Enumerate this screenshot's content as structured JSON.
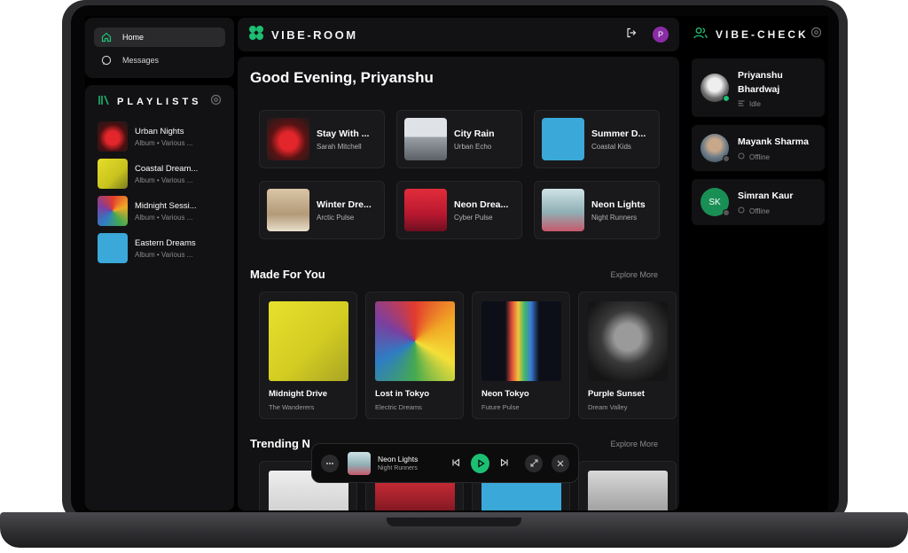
{
  "nav": {
    "items": [
      {
        "label": "Home",
        "icon": "home-icon"
      },
      {
        "label": "Messages",
        "icon": "chat-icon"
      }
    ]
  },
  "playlists": {
    "title": "PLAYLISTS",
    "items": [
      {
        "name": "Urban Nights",
        "sub": "Album • Various ..."
      },
      {
        "name": "Coastal Dream...",
        "sub": "Album • Various ..."
      },
      {
        "name": "Midnight Sessi...",
        "sub": "Album • Various ..."
      },
      {
        "name": "Eastern Dreams",
        "sub": "Album • Various ..."
      }
    ]
  },
  "header": {
    "brand": "VIBE-ROOM",
    "avatar_letter": "P"
  },
  "main": {
    "greeting": "Good Evening, Priyanshu",
    "quick_picks": [
      {
        "title": "Stay With ...",
        "artist": "Sarah Mitchell"
      },
      {
        "title": "City Rain",
        "artist": "Urban Echo"
      },
      {
        "title": "Summer D...",
        "artist": "Coastal Kids"
      },
      {
        "title": "Winter Dre...",
        "artist": "Arctic Pulse"
      },
      {
        "title": "Neon Drea...",
        "artist": "Cyber Pulse"
      },
      {
        "title": "Neon Lights",
        "artist": "Night Runners"
      }
    ],
    "made_for_you": {
      "title": "Made For You",
      "explore": "Explore More",
      "albums": [
        {
          "title": "Midnight Drive",
          "artist": "The Wanderers"
        },
        {
          "title": "Lost in Tokyo",
          "artist": "Electric Dreams"
        },
        {
          "title": "Neon Tokyo",
          "artist": "Future Pulse"
        },
        {
          "title": "Purple Sunset",
          "artist": "Dream Valley"
        }
      ]
    },
    "trending": {
      "title": "Trending N",
      "explore": "Explore More"
    }
  },
  "player": {
    "title": "Neon Lights",
    "artist": "Night Runners"
  },
  "vibe_check": {
    "title": "VIBE-CHECK",
    "friends": [
      {
        "name_line1": "Priyanshu",
        "name_line2": "Bhardwaj",
        "status": "Idle",
        "status_color": "#1dbf73"
      },
      {
        "name_line1": "Mayank Sharma",
        "name_line2": "",
        "status": "Offline",
        "status_color": "#555555"
      },
      {
        "name_line1": "Simran Kaur",
        "name_line2": "",
        "initials": "SK",
        "status": "Offline",
        "status_color": "#555555"
      }
    ]
  },
  "colors": {
    "accent": "#1dbf73",
    "avatar": "#8a2ca6",
    "panel": "#121214"
  }
}
